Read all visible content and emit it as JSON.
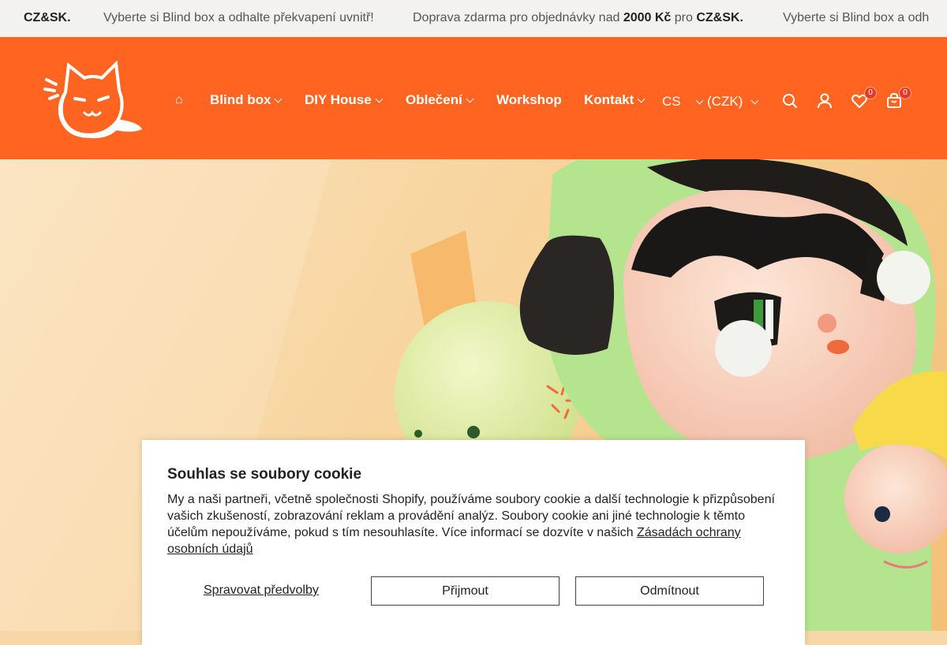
{
  "announcement": {
    "a_tail_bold": "CZ&SK.",
    "b_text": "Vyberte si Blind box a odhalte překvapení uvnitř!",
    "c_pre": "Doprava zdarma pro objednávky nad ",
    "c_bold1": "2000 Kč",
    "c_mid": " pro ",
    "c_bold2": "CZ&SK.",
    "d_text": "Vyberte si Blind box a odh"
  },
  "nav": {
    "home_icon": "home-icon",
    "items": [
      {
        "label": "Blind box"
      },
      {
        "label": "DIY House"
      },
      {
        "label": "Oblečení"
      },
      {
        "label": "Workshop"
      },
      {
        "label": "Kontakt"
      }
    ],
    "language": "CS",
    "currency": "(CZK)",
    "wishlist_count": "0",
    "cart_count": "0"
  },
  "colors": {
    "brand": "#ff6520",
    "announce_bg": "#f3f2ef",
    "badge": "#e53a2a"
  },
  "cookie": {
    "title": "Souhlas se soubory cookie",
    "body": "My a naši partneři, včetně společnosti Shopify, používáme soubory cookie a další technologie k přizpůsobení vašich zkušeností, zobrazování reklam a provádění analýz. Soubory cookie ani jiné technologie k těmto účelům nepoužíváme, pokud s tím nesouhlasíte. Více informací se dozvíte v našich ",
    "link": "Zásadách ochrany osobních údajů",
    "manage": "Spravovat předvolby",
    "accept": "Přijmout",
    "decline": "Odmítnout"
  }
}
